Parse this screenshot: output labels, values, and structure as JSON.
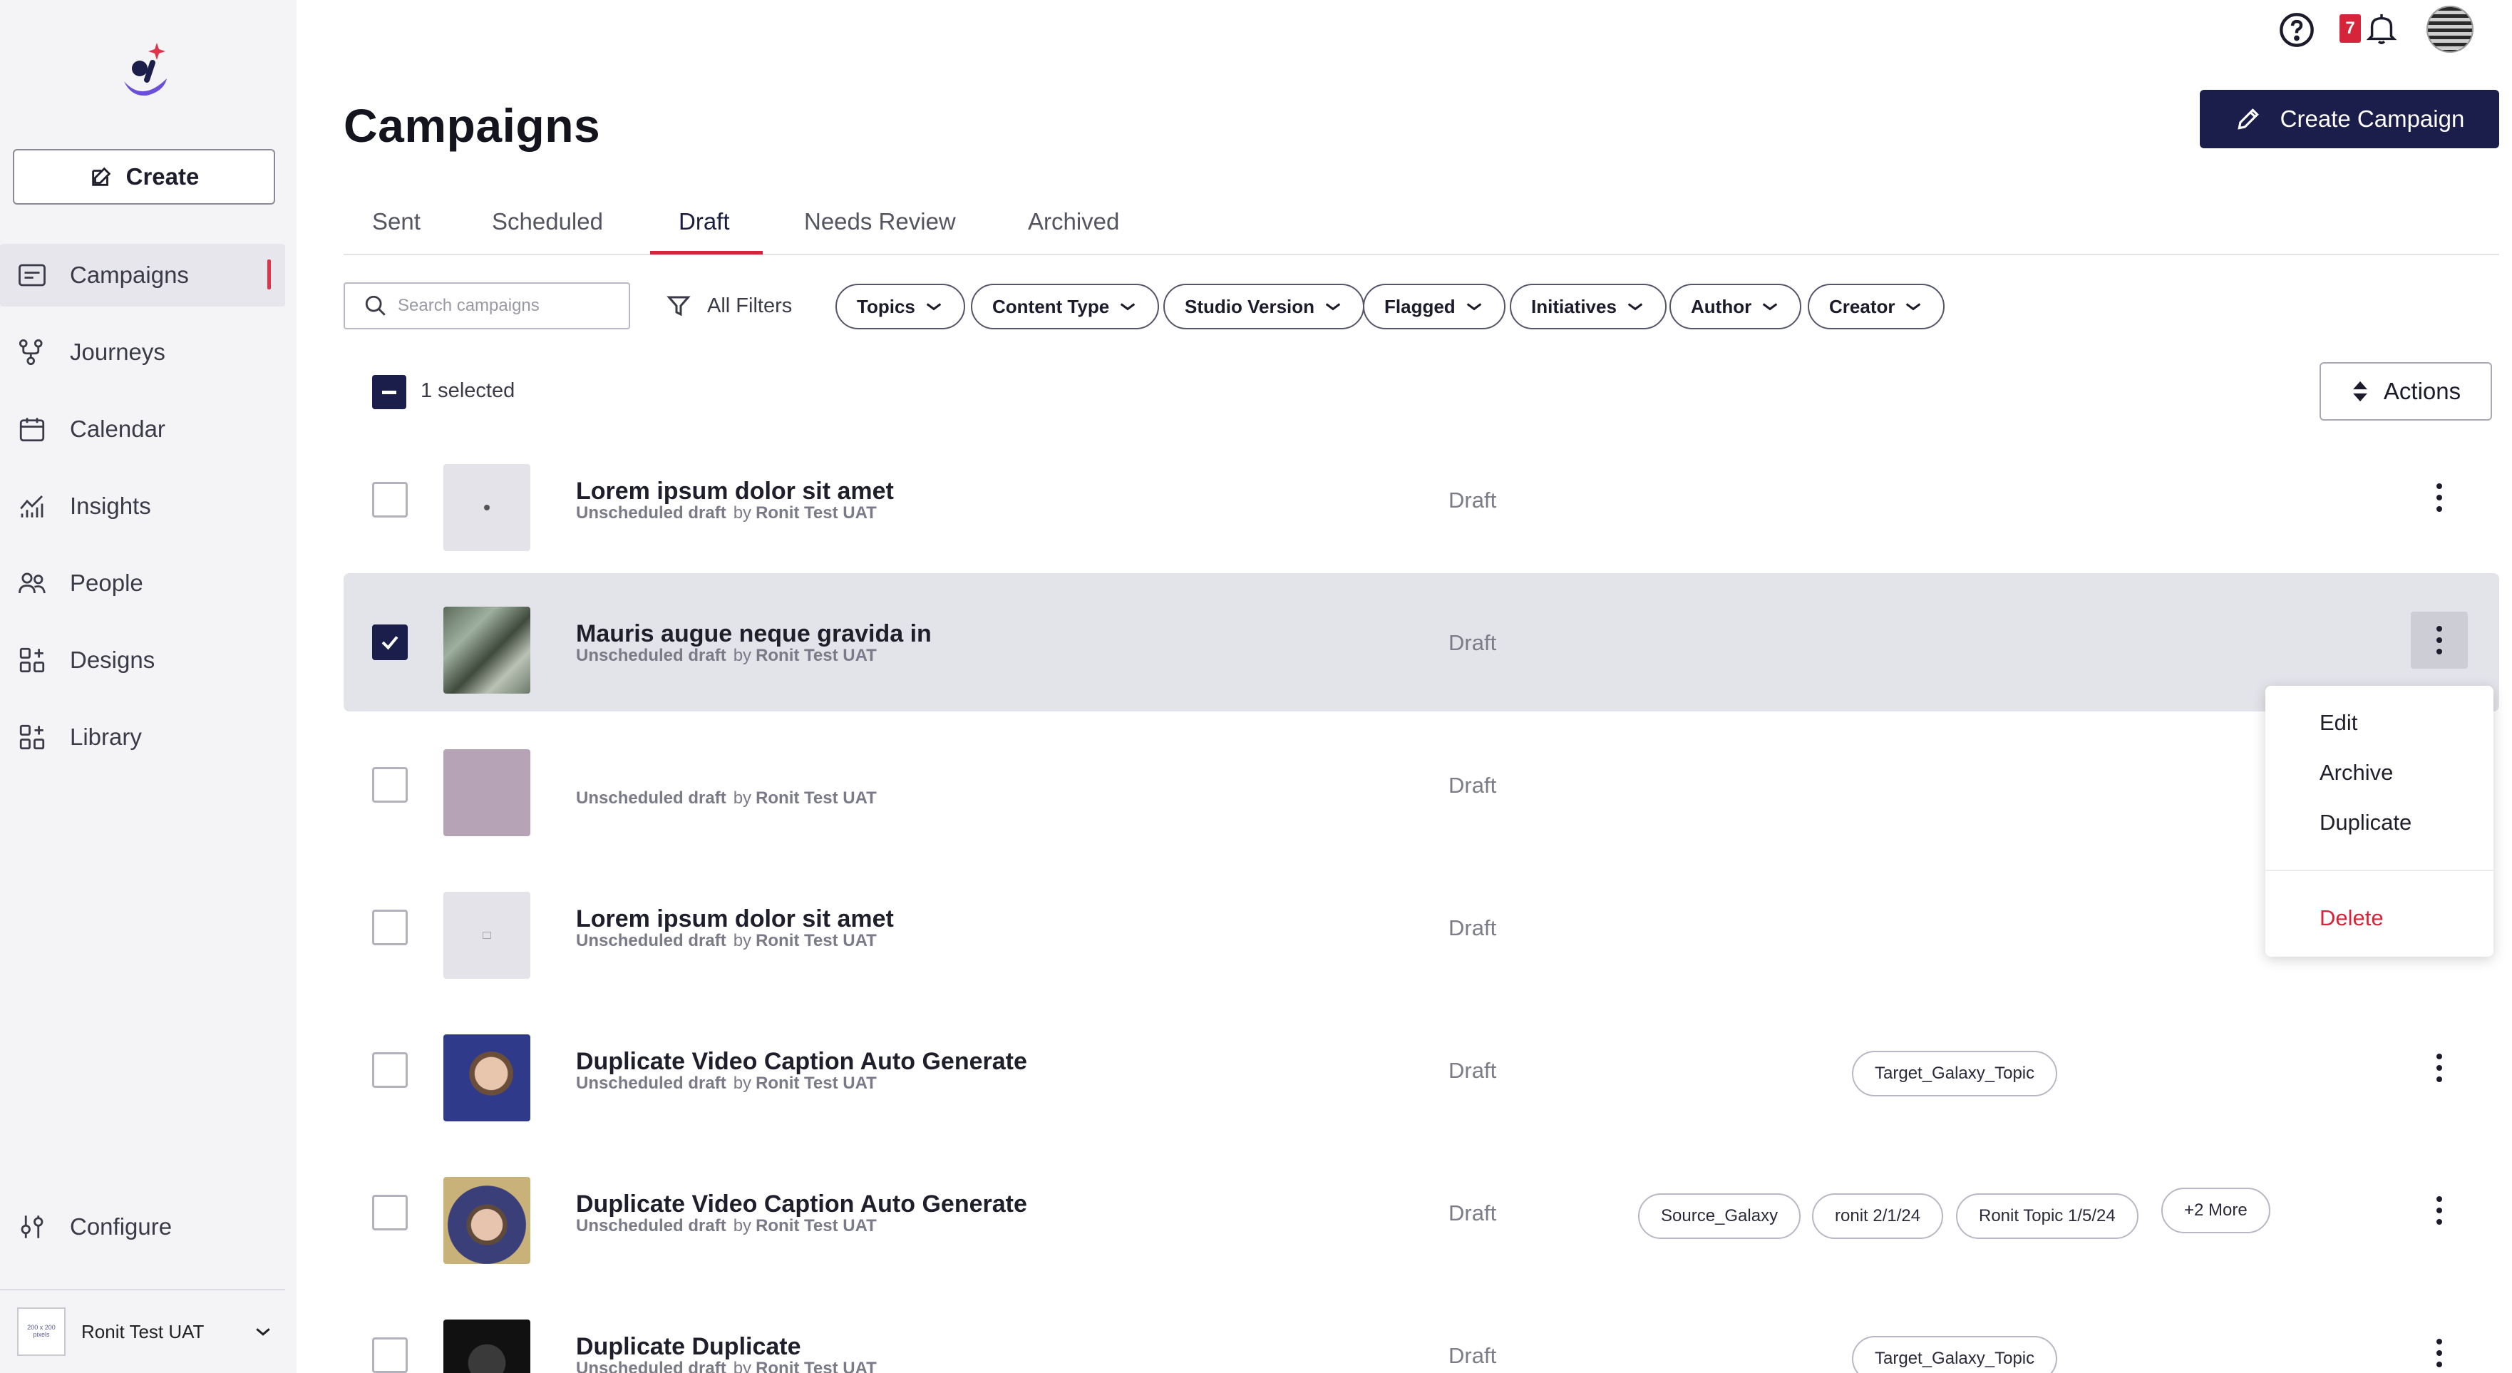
{
  "colors": {
    "accent": "#d6243a",
    "primary_navy": "#1b1d4b",
    "sidebar_bg": "#f4f4f7",
    "selected_row_bg": "#e3e3ea"
  },
  "sidebar": {
    "create_label": "Create",
    "items": [
      {
        "label": "Campaigns",
        "icon": "campaigns-icon",
        "active": true
      },
      {
        "label": "Journeys",
        "icon": "journeys-icon"
      },
      {
        "label": "Calendar",
        "icon": "calendar-icon"
      },
      {
        "label": "Insights",
        "icon": "insights-icon"
      },
      {
        "label": "People",
        "icon": "people-icon"
      },
      {
        "label": "Designs",
        "icon": "designs-icon"
      },
      {
        "label": "Library",
        "icon": "library-icon"
      }
    ],
    "configure_label": "Configure",
    "account": {
      "thumb_text": "200 x 200 pixels",
      "name": "Ronit Test UAT"
    }
  },
  "header": {
    "notification_count": "7"
  },
  "page": {
    "title": "Campaigns",
    "create_campaign_label": "Create Campaign"
  },
  "tabs": [
    "Sent",
    "Scheduled",
    "Draft",
    "Needs Review",
    "Archived"
  ],
  "active_tab": "Draft",
  "filters": {
    "search_placeholder": "Search campaigns",
    "all_filters_label": "All Filters",
    "chips": [
      "Topics",
      "Content Type",
      "Studio Version",
      "Flagged",
      "Initiatives",
      "Author",
      "Creator"
    ]
  },
  "selection": {
    "text": "1 selected",
    "actions_label": "Actions"
  },
  "rows": [
    {
      "title": "Lorem ipsum dolor sit amet",
      "status_line": "Unscheduled draft",
      "by": "by",
      "author": "Ronit Test UAT",
      "status": "Draft",
      "checked": false,
      "tags": []
    },
    {
      "title": "Mauris augue neque gravida in",
      "status_line": "Unscheduled draft",
      "by": "by",
      "author": "Ronit Test UAT",
      "status": "Draft",
      "checked": true,
      "tags": []
    },
    {
      "title": "",
      "status_line": "Unscheduled draft",
      "by": "by",
      "author": "Ronit Test UAT",
      "status": "Draft",
      "checked": false,
      "tags": []
    },
    {
      "title": "Lorem ipsum dolor sit amet",
      "status_line": "Unscheduled draft",
      "by": "by",
      "author": "Ronit Test UAT",
      "status": "Draft",
      "checked": false,
      "tags": []
    },
    {
      "title": "Duplicate Video Caption Auto Generate",
      "status_line": "Unscheduled draft",
      "by": "by",
      "author": "Ronit Test UAT",
      "status": "Draft",
      "checked": false,
      "tags": [
        "Target_Galaxy_Topic"
      ]
    },
    {
      "title": "Duplicate Video Caption Auto Generate",
      "status_line": "Unscheduled draft",
      "by": "by",
      "author": "Ronit Test UAT",
      "status": "Draft",
      "checked": false,
      "tags": [
        "Source_Galaxy",
        "ronit 2/1/24",
        "Ronit Topic 1/5/24",
        "+2 More"
      ]
    },
    {
      "title": "Duplicate Duplicate",
      "status_line": "Unscheduled draft",
      "by": "by",
      "author": "Ronit Test UAT",
      "status": "Draft",
      "checked": false,
      "tags": [
        "Target_Galaxy_Topic"
      ]
    }
  ],
  "context_menu": {
    "items": [
      "Edit",
      "Archive",
      "Duplicate"
    ],
    "danger_item": "Delete"
  }
}
